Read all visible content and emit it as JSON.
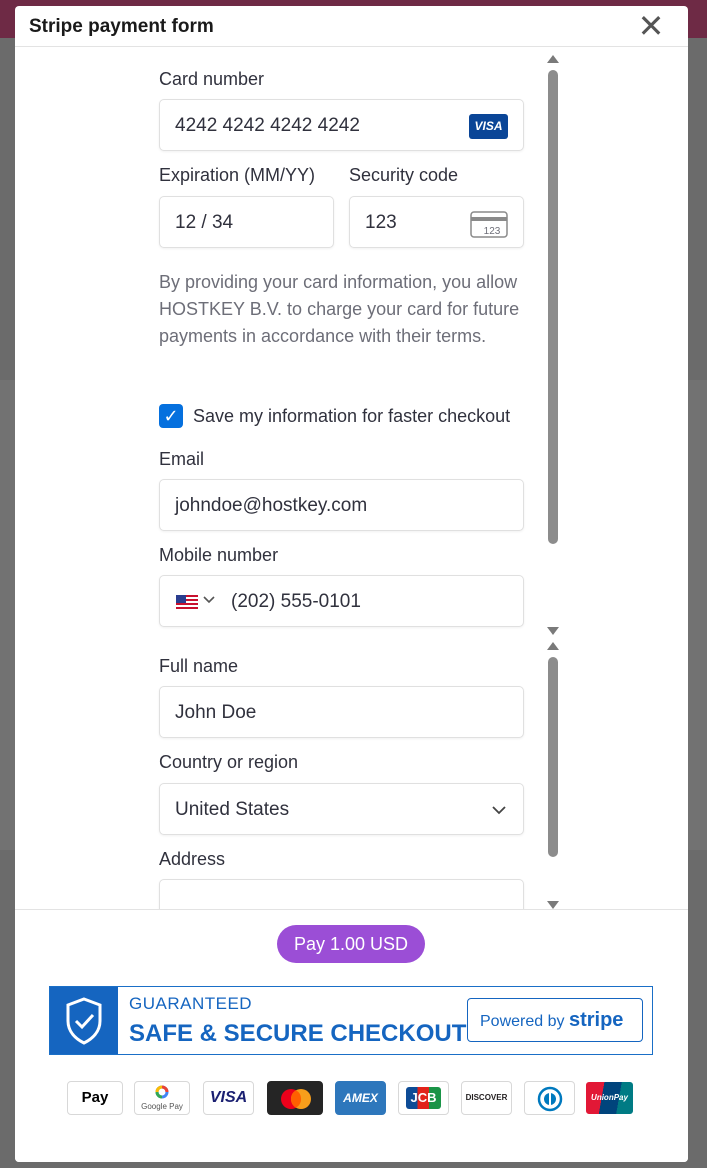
{
  "modal": {
    "title": "Stripe payment form",
    "close_symbol": "✕"
  },
  "form": {
    "card_number": {
      "label": "Card number",
      "value": "4242 4242 4242 4242",
      "brand": "VISA"
    },
    "expiration": {
      "label": "Expiration (MM/YY)",
      "value": "12 / 34"
    },
    "security_code": {
      "label": "Security code",
      "value": "123",
      "icon_text": "123"
    },
    "consent_text": "By providing your card information, you allow HOSTKEY B.V. to charge your card for future payments in accordance with their terms.",
    "save_info": {
      "checked": true,
      "label": "Save my information for faster checkout",
      "check_symbol": "✓"
    },
    "email": {
      "label": "Email",
      "value": "johndoe@hostkey.com"
    },
    "mobile": {
      "label": "Mobile number",
      "value": "(202) 555-0101"
    },
    "full_name": {
      "label": "Full name",
      "value": "John Doe"
    },
    "country": {
      "label": "Country or region",
      "value": "United States"
    },
    "address": {
      "label": "Address",
      "value": ""
    }
  },
  "footer": {
    "pay_button": "Pay 1.00 USD",
    "banner": {
      "guaranteed": "GUARANTEED",
      "secure": "SAFE & SECURE CHECKOUT",
      "powered_by": "Powered by",
      "stripe": "stripe"
    },
    "payment_methods": [
      {
        "name": "apple-pay",
        "label": " Pay"
      },
      {
        "name": "google-pay",
        "label": "Google Pay"
      },
      {
        "name": "visa",
        "label": "VISA"
      },
      {
        "name": "mastercard",
        "label": ""
      },
      {
        "name": "amex",
        "label": "AMEX"
      },
      {
        "name": "jcb",
        "label": "JCB"
      },
      {
        "name": "discover",
        "label": "DISCOVER"
      },
      {
        "name": "diners-club",
        "label": ""
      },
      {
        "name": "unionpay",
        "label": "UnionPay"
      }
    ]
  },
  "colors": {
    "accent": "#0570de",
    "pay_button": "#9b4ed6",
    "banner_blue": "#1565c0",
    "visa_blue": "#0a4597"
  }
}
